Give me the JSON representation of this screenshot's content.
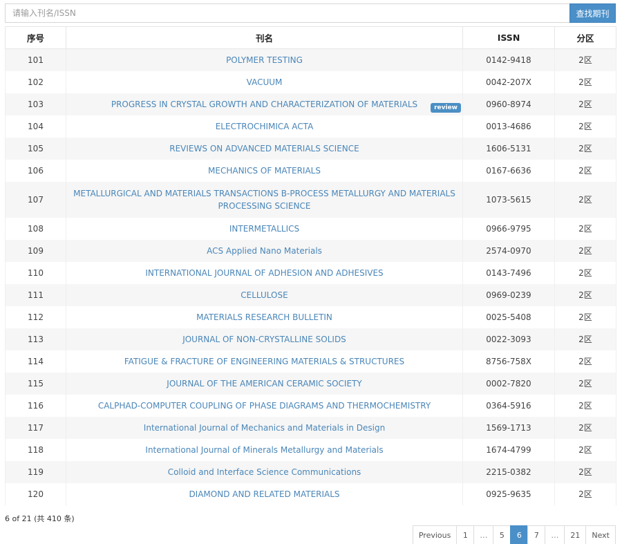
{
  "search": {
    "placeholder": "请输入刊名/ISSN",
    "value": "",
    "button_label": "查找期刊"
  },
  "table": {
    "headers": [
      "序号",
      "刊名",
      "ISSN",
      "分区"
    ],
    "rows": [
      {
        "no": "101",
        "name": "POLYMER TESTING",
        "issn": "0142-9418",
        "zone": "2区"
      },
      {
        "no": "102",
        "name": "VACUUM",
        "issn": "0042-207X",
        "zone": "2区"
      },
      {
        "no": "103",
        "name": "PROGRESS IN CRYSTAL GROWTH AND CHARACTERIZATION OF MATERIALS",
        "issn": "0960-8974",
        "zone": "2区",
        "badge": "review"
      },
      {
        "no": "104",
        "name": "ELECTROCHIMICA ACTA",
        "issn": "0013-4686",
        "zone": "2区"
      },
      {
        "no": "105",
        "name": "REVIEWS ON ADVANCED MATERIALS SCIENCE",
        "issn": "1606-5131",
        "zone": "2区"
      },
      {
        "no": "106",
        "name": "MECHANICS OF MATERIALS",
        "issn": "0167-6636",
        "zone": "2区"
      },
      {
        "no": "107",
        "name": "METALLURGICAL AND MATERIALS TRANSACTIONS B-PROCESS METALLURGY AND MATERIALS PROCESSING SCIENCE",
        "issn": "1073-5615",
        "zone": "2区"
      },
      {
        "no": "108",
        "name": "INTERMETALLICS",
        "issn": "0966-9795",
        "zone": "2区"
      },
      {
        "no": "109",
        "name": "ACS Applied Nano Materials",
        "issn": "2574-0970",
        "zone": "2区"
      },
      {
        "no": "110",
        "name": "INTERNATIONAL JOURNAL OF ADHESION AND ADHESIVES",
        "issn": "0143-7496",
        "zone": "2区"
      },
      {
        "no": "111",
        "name": "CELLULOSE",
        "issn": "0969-0239",
        "zone": "2区"
      },
      {
        "no": "112",
        "name": "MATERIALS RESEARCH BULLETIN",
        "issn": "0025-5408",
        "zone": "2区"
      },
      {
        "no": "113",
        "name": "JOURNAL OF NON-CRYSTALLINE SOLIDS",
        "issn": "0022-3093",
        "zone": "2区"
      },
      {
        "no": "114",
        "name": "FATIGUE & FRACTURE OF ENGINEERING MATERIALS & STRUCTURES",
        "issn": "8756-758X",
        "zone": "2区"
      },
      {
        "no": "115",
        "name": "JOURNAL OF THE AMERICAN CERAMIC SOCIETY",
        "issn": "0002-7820",
        "zone": "2区"
      },
      {
        "no": "116",
        "name": "CALPHAD-COMPUTER COUPLING OF PHASE DIAGRAMS AND THERMOCHEMISTRY",
        "issn": "0364-5916",
        "zone": "2区"
      },
      {
        "no": "117",
        "name": "International Journal of Mechanics and Materials in Design",
        "issn": "1569-1713",
        "zone": "2区"
      },
      {
        "no": "118",
        "name": "International Journal of Minerals Metallurgy and Materials",
        "issn": "1674-4799",
        "zone": "2区"
      },
      {
        "no": "119",
        "name": "Colloid and Interface Science Communications",
        "issn": "2215-0382",
        "zone": "2区"
      },
      {
        "no": "120",
        "name": "DIAMOND AND RELATED MATERIALS",
        "issn": "0925-9635",
        "zone": "2区"
      }
    ]
  },
  "summary": "6 of 21 (共 410 条)",
  "pagination": {
    "items": [
      {
        "label": "Previous",
        "type": "prev"
      },
      {
        "label": "1",
        "type": "page"
      },
      {
        "label": "…",
        "type": "ellipsis"
      },
      {
        "label": "5",
        "type": "page"
      },
      {
        "label": "6",
        "type": "page",
        "active": true
      },
      {
        "label": "7",
        "type": "page"
      },
      {
        "label": "…",
        "type": "ellipsis"
      },
      {
        "label": "21",
        "type": "page"
      },
      {
        "label": "Next",
        "type": "next"
      }
    ]
  },
  "colors": {
    "accent": "#4a8fc8",
    "link": "#4a86b8",
    "stripe": "#f6f6f6"
  }
}
